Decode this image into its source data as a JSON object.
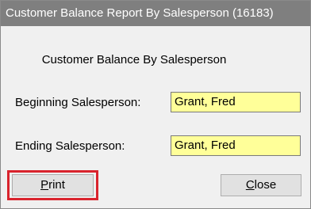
{
  "window": {
    "title": "Customer Balance Report By Salesperson (16183)"
  },
  "form": {
    "heading": "Customer Balance By Salesperson",
    "beginning_label": "Beginning Salesperson:",
    "beginning_value": "Grant, Fred",
    "ending_label": "Ending Salesperson:",
    "ending_value": "Grant, Fred"
  },
  "buttons": {
    "print_mnemonic": "P",
    "print_rest": "rint",
    "close_mnemonic": "C",
    "close_rest": "lose"
  },
  "colors": {
    "titlebar": "#7f7f7f",
    "field_background": "#ffff99",
    "highlight": "#d9232d"
  }
}
